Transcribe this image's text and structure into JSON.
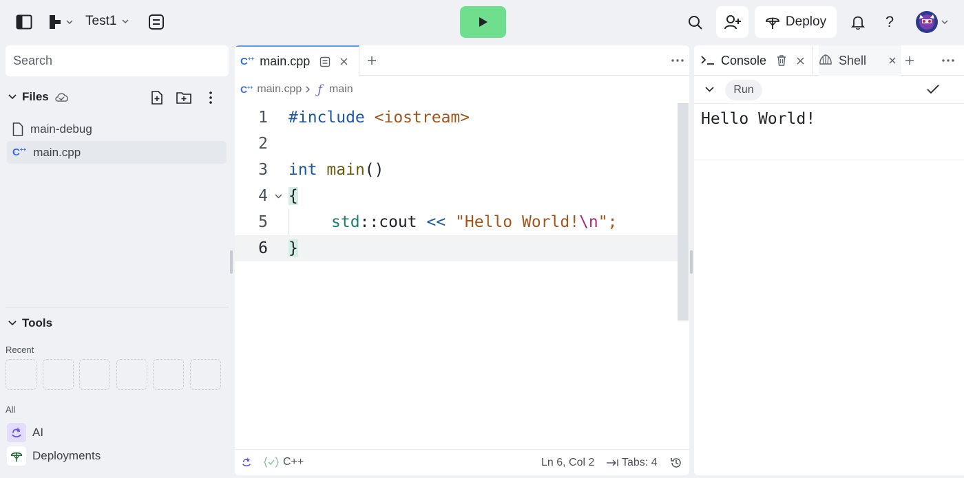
{
  "topbar": {
    "project_name": "Test1",
    "deploy_label": "Deploy"
  },
  "sidebar": {
    "search_placeholder": "Search",
    "files_label": "Files",
    "files": [
      {
        "name": "main-debug",
        "icon": "file-icon"
      },
      {
        "name": "main.cpp",
        "icon": "cpp-icon"
      }
    ],
    "tools_label": "Tools",
    "recent_label": "Recent",
    "all_label": "All",
    "tools": [
      {
        "name": "AI",
        "icon": "ai-icon"
      },
      {
        "name": "Deployments",
        "icon": "deploy-icon"
      }
    ]
  },
  "editor": {
    "tab_label": "main.cpp",
    "breadcrumb_file": "main.cpp",
    "breadcrumb_symbol": "main",
    "status_language": "C++",
    "status_position": "Ln 6, Col 2",
    "status_tabs": "Tabs: 4",
    "lines": [
      "1",
      "2",
      "3",
      "4",
      "5",
      "6"
    ],
    "code": {
      "line1_directive": "#include",
      "line1_header": "<iostream>",
      "line3_type": "int",
      "line3_func": "main",
      "line3_parens": "()",
      "line4_brace": "{",
      "line5_ns": "std",
      "line5_scope": "::cout",
      "line5_op": "<<",
      "line5_str": "\"Hello World!",
      "line5_esc": "\\n",
      "line5_end": "\";",
      "line6_brace": "}"
    }
  },
  "console": {
    "tab_console": "Console",
    "tab_shell": "Shell",
    "run_label": "Run",
    "output": "Hello World!"
  },
  "colors": {
    "run_button": "#6fdf8e",
    "tab_accent": "#5b9af5",
    "background": "#eff1f4"
  }
}
